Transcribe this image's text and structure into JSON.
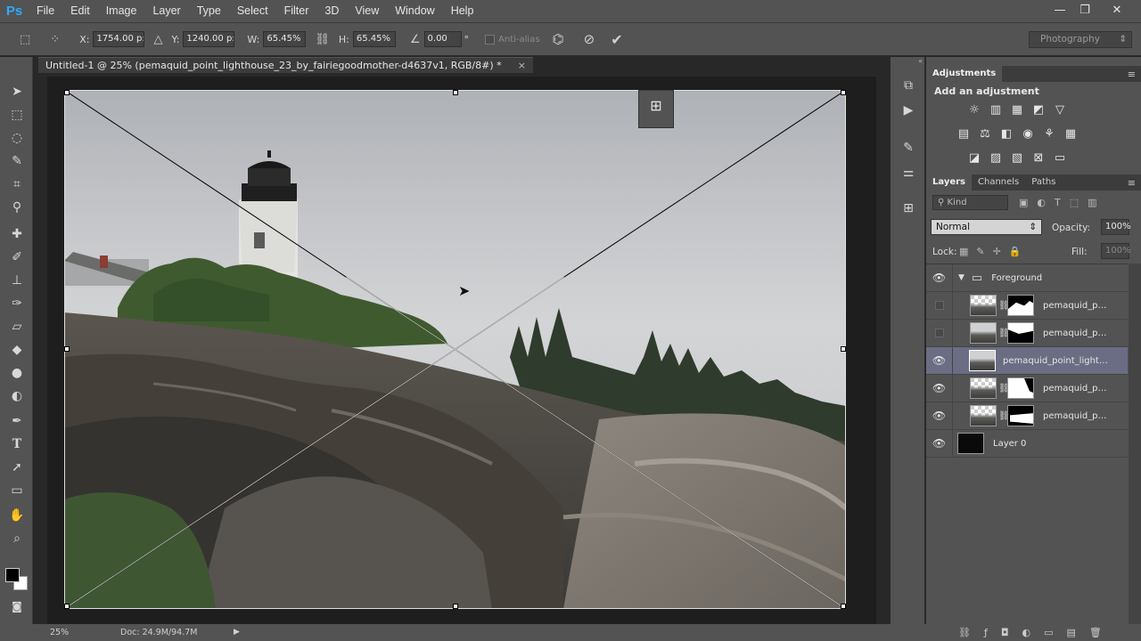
{
  "app": {
    "logo": "Ps"
  },
  "menu": [
    "File",
    "Edit",
    "Image",
    "Layer",
    "Type",
    "Select",
    "Filter",
    "3D",
    "View",
    "Window",
    "Help"
  ],
  "window_controls": {
    "minimize": "—",
    "restore": "❐",
    "close": "✕"
  },
  "options": {
    "x_label": "X:",
    "x_value": "1754.00 p:",
    "y_label": "Y:",
    "y_value": "1240.00 p:",
    "w_label": "W:",
    "w_value": "65.45%",
    "h_label": "H:",
    "h_value": "65.45%",
    "angle_value": "0.00",
    "angle_unit": "°",
    "antialias_label": "Anti-alias",
    "workspace": "Photography"
  },
  "document": {
    "tab_title": "Untitled-1 @ 25% (pemaquid_point_lighthouse_23_by_fairiegoodmother-d4637v1, RGB/8#) *",
    "tab_close": "×"
  },
  "status": {
    "zoom": "25%",
    "doc_size": "Doc: 24.9M/94.7M"
  },
  "panels": {
    "adjustments_tab": "Adjustments",
    "add_adjustment": "Add an adjustment",
    "layers_tabs": [
      "Layers",
      "Channels",
      "Paths"
    ],
    "filter_kind": "Kind",
    "blend_mode": "Normal",
    "opacity_label": "Opacity:",
    "opacity_value": "100%",
    "lock_label": "Lock:",
    "fill_label": "Fill:",
    "fill_value": "100%"
  },
  "layers": [
    {
      "name": "Foreground",
      "group": true
    },
    {
      "name": "pemaquid_poi..."
    },
    {
      "name": "pemaquid_poi..."
    },
    {
      "name": "pemaquid_point_lightho..."
    },
    {
      "name": "pemaquid_poi..."
    },
    {
      "name": "pemaquid_poi..."
    },
    {
      "name": "Layer 0"
    }
  ]
}
